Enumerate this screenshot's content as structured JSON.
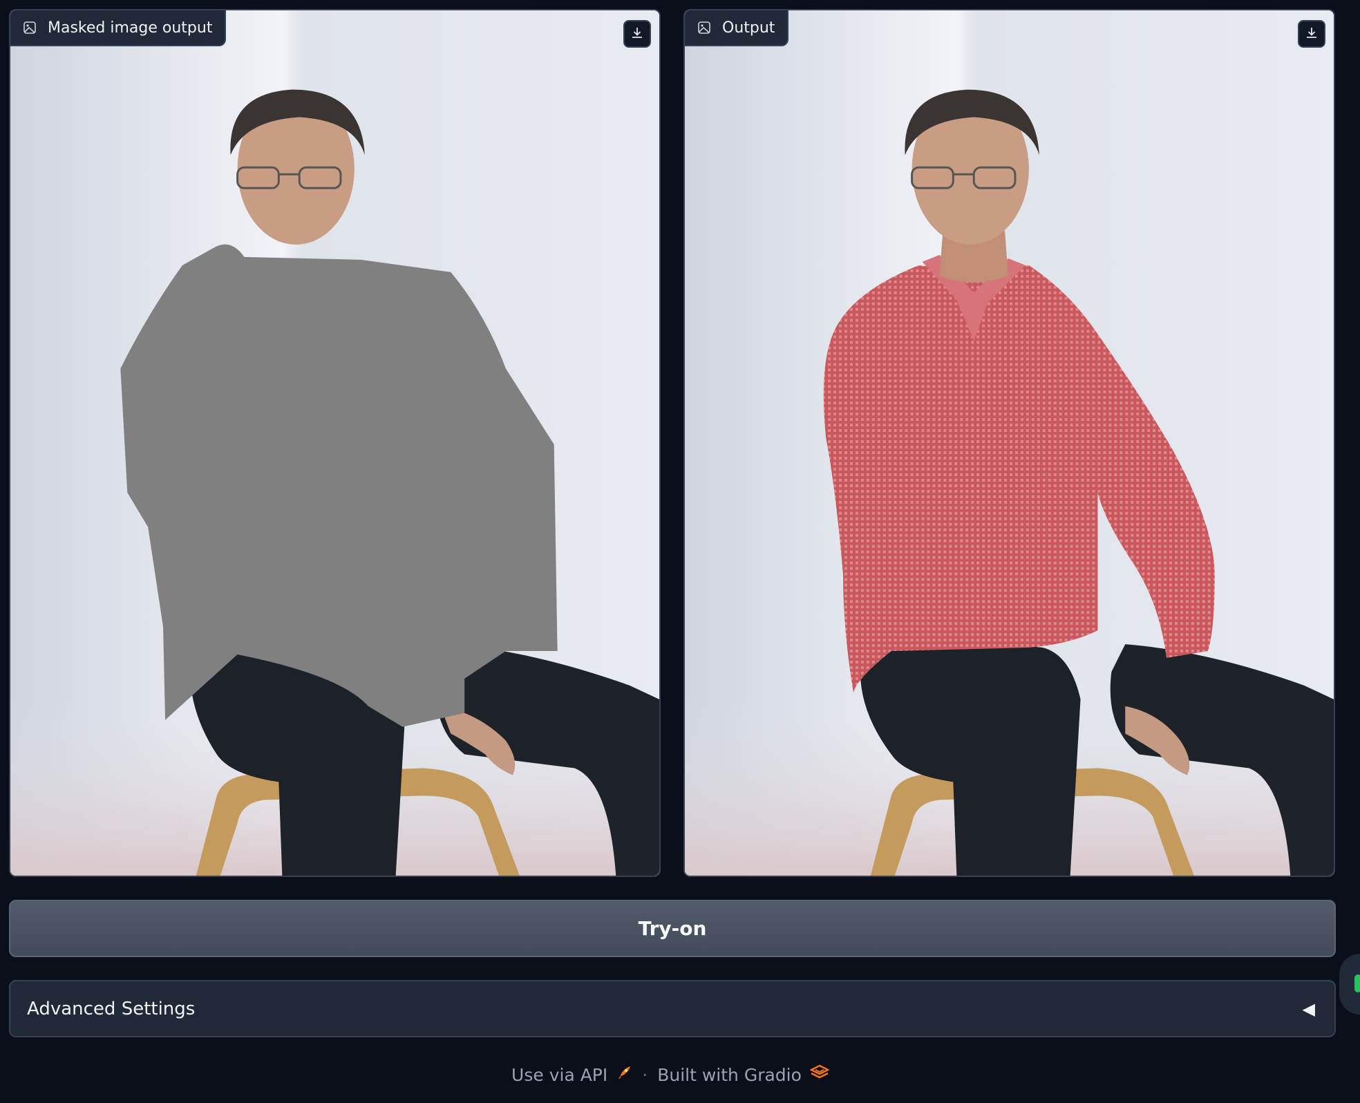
{
  "panels": {
    "left": {
      "label": "Masked image output",
      "icon": "image-icon",
      "download_icon": "download-icon"
    },
    "right": {
      "label": "Output",
      "icon": "image-icon",
      "download_icon": "download-icon"
    }
  },
  "actions": {
    "try_on_label": "Try-on"
  },
  "accordion": {
    "title": "Advanced Settings",
    "arrow": "◀"
  },
  "footer": {
    "api_label": "Use via API",
    "separator": "·",
    "built_label": "Built with Gradio",
    "api_icon": "rocket-icon",
    "gradio_icon": "gradio-logo-icon"
  },
  "colors": {
    "background": "#0b0f19",
    "panel_border": "#374151",
    "button_bg": "#4b5563",
    "mask_gray": "#808080",
    "shirt_red": "#c9585e"
  }
}
